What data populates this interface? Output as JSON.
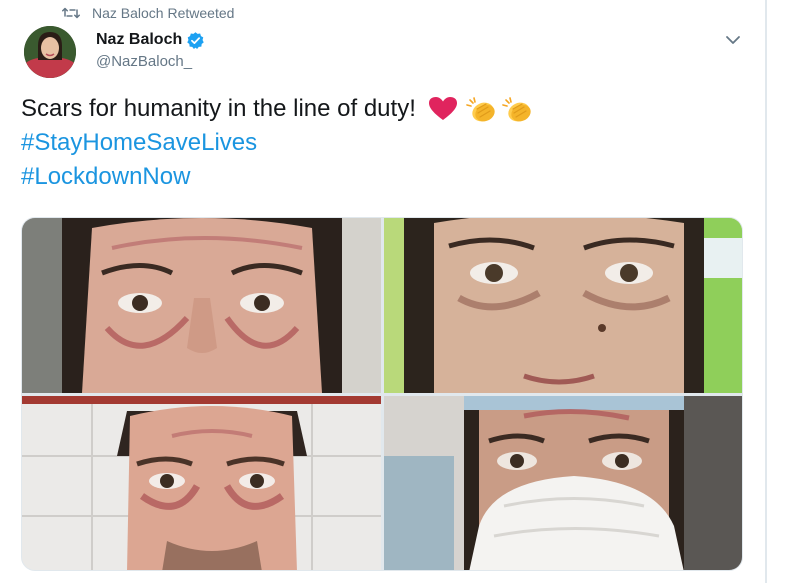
{
  "retweet": {
    "label": "Naz Baloch Retweeted",
    "icon": "retweet-icon"
  },
  "author": {
    "display_name": "Naz Baloch",
    "handle": "@NazBaloch_",
    "verified": true,
    "verified_icon": "verified-badge-icon"
  },
  "tweet": {
    "text": "Scars for humanity in the line of duty!",
    "emojis": [
      "red-heart-icon",
      "clapping-hands-icon",
      "clapping-hands-icon"
    ],
    "hashtags": [
      "#StayHomeSaveLives",
      "#LockdownNow"
    ]
  },
  "menu_icon": "chevron-down-icon",
  "media": {
    "count": 4
  },
  "colors": {
    "hashtag": "#1b95e0",
    "verified": "#1da1f2",
    "secondary_text": "#657786",
    "primary_text": "#14171a",
    "heart": "#e0245e"
  }
}
